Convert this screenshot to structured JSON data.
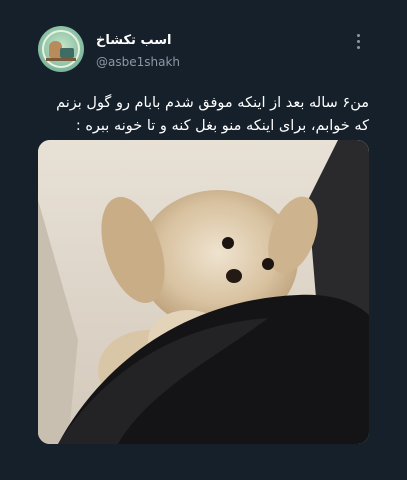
{
  "tweet": {
    "author_name": "اسب تکشاخ",
    "author_handle": "@asbe1shakh",
    "text": "من۶ ساله بعد از اینکه موفق شدم بابام رو گول بزنم که خوابم، برای اینکه منو بغل کنه و تا خونه ببره :"
  },
  "icons": {
    "avatar": "unicorn-laptop-avatar-icon",
    "more": "more-vertical-icon"
  },
  "colors": {
    "background": "#15202b",
    "text_primary": "#ffffff",
    "text_secondary": "#8b98a5"
  }
}
